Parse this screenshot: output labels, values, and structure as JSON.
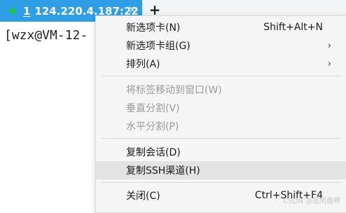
{
  "tab": {
    "number": "1",
    "title": "124.220.4.187:22",
    "close_icon": "×",
    "add_icon": "+",
    "status_color": "#22c24a"
  },
  "terminal": {
    "prompt": "[wzx@VM-12-"
  },
  "menu": {
    "items": [
      {
        "label": "新选项卡(N)",
        "shortcut": "Shift+Alt+N"
      },
      {
        "label": "新选项卡组(G)",
        "submenu": "›"
      },
      {
        "label": "排列(A)",
        "submenu": "›"
      },
      {
        "label": "将标签移动到窗口(W)"
      },
      {
        "label": "垂直分割(V)"
      },
      {
        "label": "水平分割(P)"
      },
      {
        "label": "复制会话(D)"
      },
      {
        "label": "复制SSH渠道(H)"
      },
      {
        "label": "关闭(C)",
        "shortcut": "Ctrl+Shift+F4"
      }
    ]
  },
  "watermark": "CSDN @是阿茜啊"
}
